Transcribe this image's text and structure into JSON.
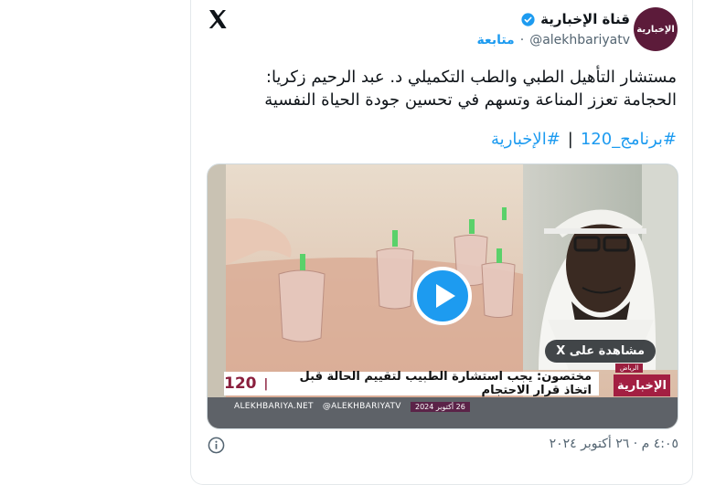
{
  "tweet": {
    "author_name": "قناة الإخبارية",
    "handle": "@alekhbariyatv",
    "follow_label": "متابعة",
    "separator": "·",
    "avatar_text": "الإخبارية",
    "text_line1": "مستشار التأهيل الطبي والطب التكميلي د. عبد الرحيم زكريا:",
    "text_line2": "الحجامة تعزز المناعة وتسهم في تحسين جودة الحياة النفسية",
    "hashtags": [
      "#برنامج_120",
      "#الإخبارية"
    ],
    "hashtag_separator": "|",
    "timestamp": "٤:٠٥ م · ٢٦ أكتوبر ٢٠٢٤"
  },
  "media": {
    "watch_label": "مشاهدة على X",
    "ticker_text": "مختصون: يجب استشارة الطبيب لتقييم الحالة قبل اتخاذ قرار الاحتجام",
    "program_number": "120",
    "city_label": "الرياض",
    "channel_logo_text": "الإخبارية",
    "url1": "ALEKHBARIYA.NET",
    "url2": "@ALEKHBARIYATV",
    "date_badge": "26 أكتوبر 2024"
  },
  "icons": {
    "brand": "x-logo-icon",
    "verified": "verified-badge-icon",
    "play": "play-icon",
    "info": "info-icon"
  },
  "colors": {
    "accent": "#1d9bf0",
    "text": "#0f1419",
    "muted": "#536471",
    "channel": "#a31f42"
  }
}
